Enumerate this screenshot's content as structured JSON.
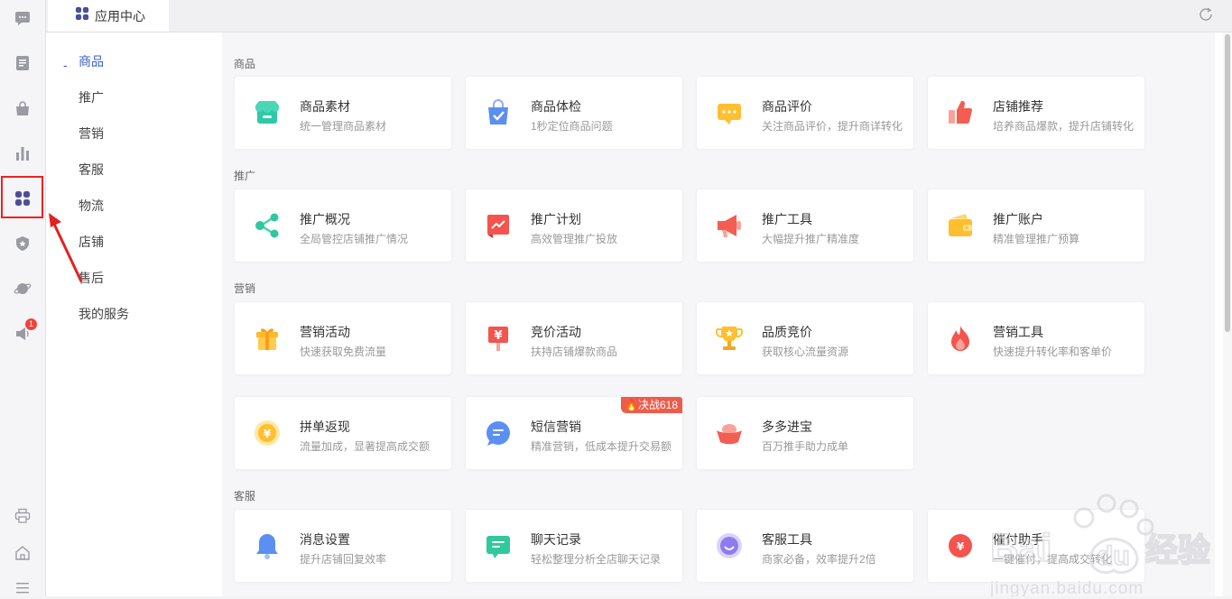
{
  "app": {
    "tab_label": "应用中心",
    "notification_count": "1"
  },
  "rail": {
    "icons": [
      "chat-icon",
      "document-icon",
      "bag-icon",
      "chart-icon",
      "apps-icon",
      "shield-star-icon",
      "planet-icon",
      "megaphone-icon",
      "printer-icon",
      "home-icon",
      "menu-icon"
    ],
    "active": "apps-icon"
  },
  "categories": [
    "商品",
    "推广",
    "营销",
    "客服",
    "物流",
    "店铺",
    "售后",
    "我的服务"
  ],
  "sections": [
    {
      "title": "商品",
      "cards": [
        {
          "title": "商品素材",
          "desc": "统一管理商品素材",
          "icon": "store-icon"
        },
        {
          "title": "商品体检",
          "desc": "1秒定位商品问题",
          "icon": "check-bag-icon"
        },
        {
          "title": "商品评价",
          "desc": "关注商品评价，提升商详转化",
          "icon": "comment-icon"
        },
        {
          "title": "店铺推荐",
          "desc": "培养商品爆款，提升店铺转化",
          "icon": "thumbs-up-icon"
        }
      ]
    },
    {
      "title": "推广",
      "cards": [
        {
          "title": "推广概况",
          "desc": "全局管控店铺推广情况",
          "icon": "share-icon"
        },
        {
          "title": "推广计划",
          "desc": "高效管理推广投放",
          "icon": "trend-icon"
        },
        {
          "title": "推广工具",
          "desc": "大幅提升推广精准度",
          "icon": "megaphone-icon"
        },
        {
          "title": "推广账户",
          "desc": "精准管理推广预算",
          "icon": "wallet-icon"
        }
      ]
    },
    {
      "title": "营销",
      "cards": [
        {
          "title": "营销活动",
          "desc": "快速获取免费流量",
          "icon": "gift-icon"
        },
        {
          "title": "竞价活动",
          "desc": "扶持店铺爆款商品",
          "icon": "yen-sign-icon"
        },
        {
          "title": "品质竞价",
          "desc": "获取核心流量资源",
          "icon": "trophy-icon"
        },
        {
          "title": "营销工具",
          "desc": "快速提升转化率和客单价",
          "icon": "flame-icon"
        },
        {
          "title": "拼单返现",
          "desc": "流量加成，显著提高成交额",
          "icon": "coin-icon"
        },
        {
          "title": "短信营销",
          "desc": "精准营销，低成本提升交易额",
          "icon": "sms-icon",
          "promo": "决战618"
        },
        {
          "title": "多多进宝",
          "desc": "百万推手助力成单",
          "icon": "ingot-icon"
        }
      ]
    },
    {
      "title": "客服",
      "cards": [
        {
          "title": "消息设置",
          "desc": "提升店铺回复效率",
          "icon": "bell-icon"
        },
        {
          "title": "聊天记录",
          "desc": "轻松整理分析全店聊天记录",
          "icon": "chat-record-icon"
        },
        {
          "title": "客服工具",
          "desc": "商家必备，效率提升2倍",
          "icon": "headset-icon"
        },
        {
          "title": "催付助手",
          "desc": "一键催付，提高成交转化",
          "icon": "remind-icon"
        }
      ]
    }
  ],
  "watermark": {
    "brand": "Bai du 经验",
    "url": "jingyan.baidu.com"
  },
  "colors": {
    "accent": "#3a5fcd",
    "annotation": "#e22222",
    "promo": "#ef5b4a"
  }
}
